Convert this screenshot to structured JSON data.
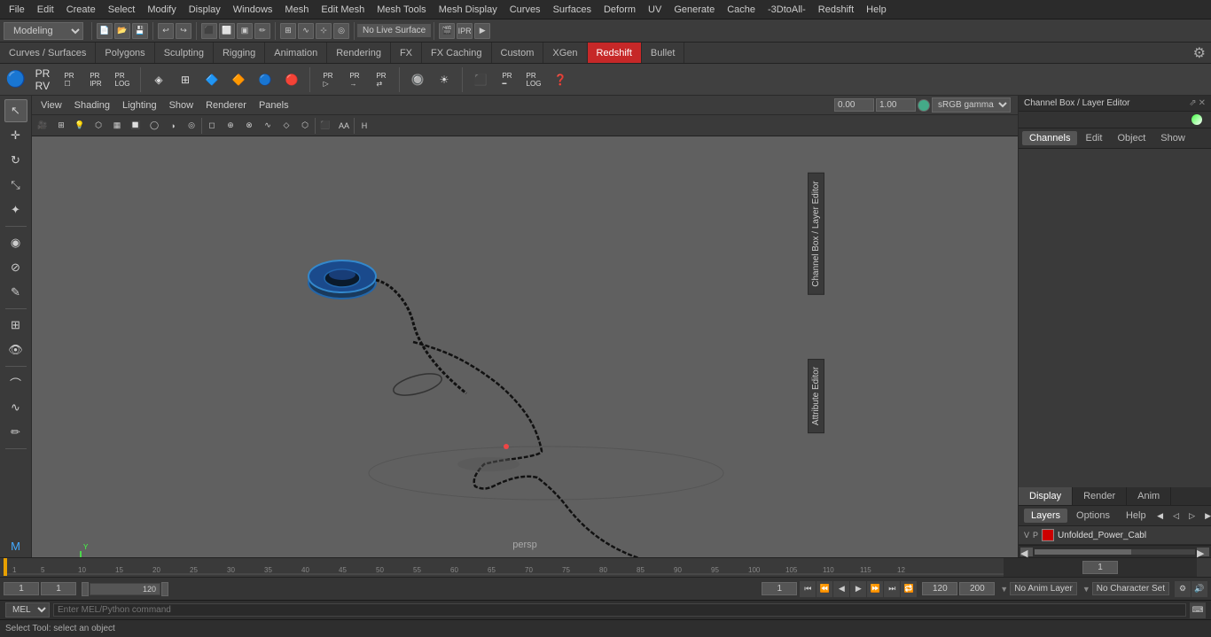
{
  "menubar": {
    "items": [
      "File",
      "Edit",
      "Create",
      "Select",
      "Modify",
      "Display",
      "Windows",
      "Mesh",
      "Edit Mesh",
      "Mesh Tools",
      "Mesh Display",
      "Curves",
      "Surfaces",
      "Deform",
      "UV",
      "Generate",
      "Cache",
      "-3DtoAll-",
      "Redshift",
      "Help"
    ]
  },
  "workspace": {
    "label": "Modeling",
    "dropdown_value": "Modeling"
  },
  "tabs": {
    "items": [
      "Curves / Surfaces",
      "Polygons",
      "Sculpting",
      "Rigging",
      "Animation",
      "Rendering",
      "FX",
      "FX Caching",
      "Custom",
      "XGen",
      "Redshift",
      "Bullet"
    ],
    "active": "Redshift"
  },
  "viewport": {
    "menus": [
      "View",
      "Shading",
      "Lighting",
      "Show",
      "Renderer",
      "Panels"
    ],
    "persp_label": "persp",
    "gamma_value": "0.00",
    "gamma_scale": "1.00",
    "color_profile": "sRGB gamma"
  },
  "channel_box": {
    "title": "Channel Box / Layer Editor",
    "tabs": [
      "Channels",
      "Edit",
      "Object",
      "Show"
    ],
    "display_tabs": [
      "Display",
      "Render",
      "Anim"
    ],
    "active_display_tab": "Display",
    "layer_tabs": [
      "Layers",
      "Options",
      "Help"
    ]
  },
  "layer": {
    "v_label": "V",
    "p_label": "P",
    "name": "Unfolded_Power_Cabl",
    "color": "#cc0000"
  },
  "timeline": {
    "current_frame": "1",
    "start_frame": "1",
    "end_frame": "120",
    "range_start": "1",
    "range_end": "120",
    "max_frame": "200"
  },
  "playback": {
    "buttons": [
      "⏮",
      "⏪",
      "◀",
      "▶",
      "▶▶",
      "⏩",
      "⏭"
    ],
    "frame_label": "1"
  },
  "bottom_bar": {
    "no_anim_layer": "No Anim Layer",
    "no_char_set": "No Character Set",
    "mel_label": "MEL",
    "status_text": "Select Tool: select an object"
  }
}
